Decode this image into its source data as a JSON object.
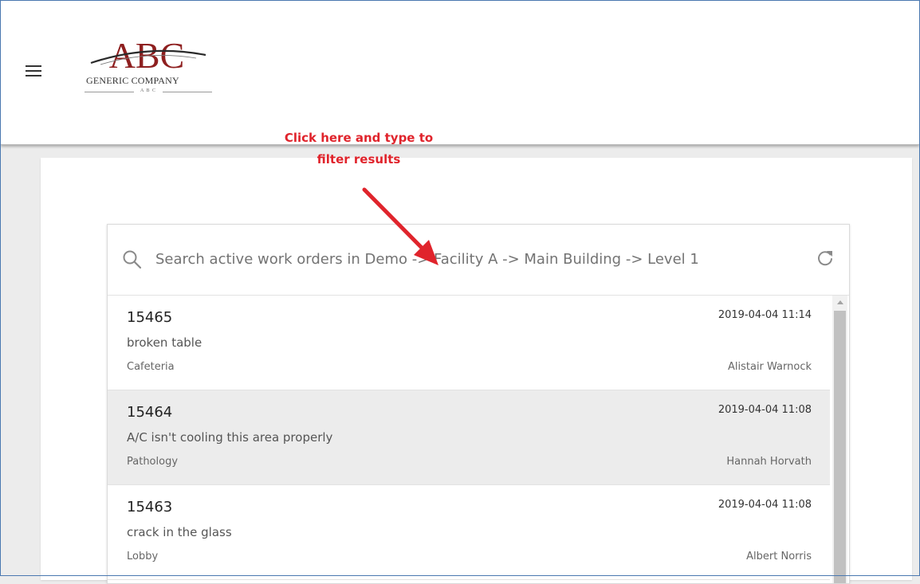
{
  "header": {
    "logo": {
      "mark": "ABC",
      "name": "GENERIC COMPANY",
      "sub": "A B C"
    }
  },
  "annotation": {
    "line1": "Click here and type to",
    "line2": "filter results",
    "color": "#e0242c"
  },
  "search": {
    "placeholder": "Search active work orders in Demo -> Facility A -> Main Building -> Level 1",
    "value": ""
  },
  "work_orders": [
    {
      "id": "15465",
      "description": "broken table",
      "location": "Cafeteria",
      "date": "2019-04-04 11:14",
      "assignee": "Alistair Warnock"
    },
    {
      "id": "15464",
      "description": "A/C isn't cooling this area properly",
      "location": "Pathology",
      "date": "2019-04-04 11:08",
      "assignee": "Hannah Horvath"
    },
    {
      "id": "15463",
      "description": "crack in the glass",
      "location": "Lobby",
      "date": "2019-04-04 11:08",
      "assignee": "Albert Norris"
    }
  ],
  "icons": {
    "menu": "hamburger-menu-icon",
    "search": "search-icon",
    "refresh": "refresh-icon"
  }
}
